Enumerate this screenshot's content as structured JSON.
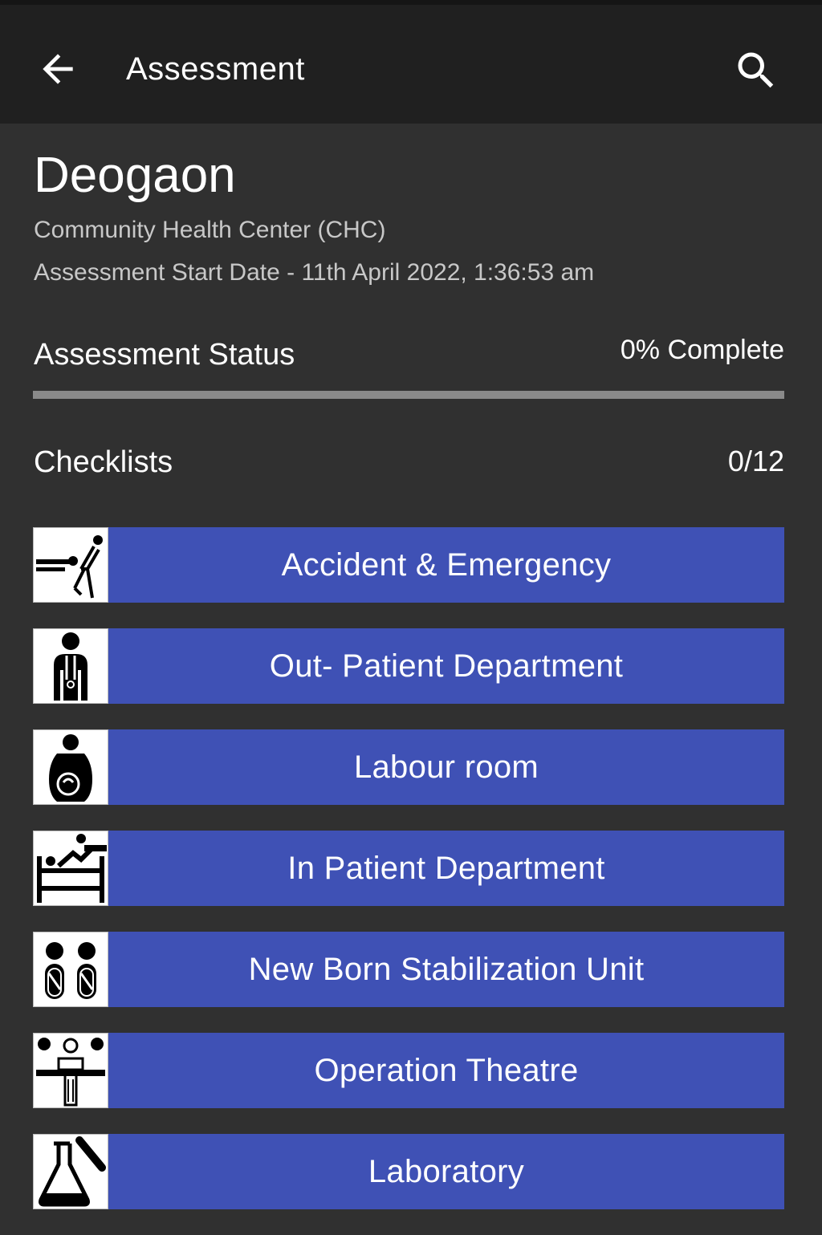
{
  "appbar": {
    "title": "Assessment",
    "back_icon": "arrow-left-icon",
    "search_icon": "search-icon"
  },
  "facility": {
    "name": "Deogaon",
    "type": "Community Health Center (CHC)",
    "start_date": "Assessment Start Date - 11th April 2022, 1:36:53 am"
  },
  "status": {
    "label": "Assessment Status",
    "value": "0% Complete",
    "progress_percent": 0
  },
  "checklists": {
    "label": "Checklists",
    "count": "0/12",
    "items": [
      {
        "label": "Accident & Emergency",
        "icon": "emergency-icon"
      },
      {
        "label": "Out- Patient Department",
        "icon": "doctor-icon"
      },
      {
        "label": "Labour room",
        "icon": "pregnant-woman-icon"
      },
      {
        "label": "In Patient Department",
        "icon": "hospital-bed-icon"
      },
      {
        "label": "New Born Stabilization Unit",
        "icon": "newborn-icon"
      },
      {
        "label": "Operation Theatre",
        "icon": "surgery-icon"
      },
      {
        "label": "Laboratory",
        "icon": "lab-flask-icon"
      }
    ]
  },
  "colors": {
    "accent": "#3f51b5",
    "background": "#303030",
    "appbar": "#202020"
  }
}
